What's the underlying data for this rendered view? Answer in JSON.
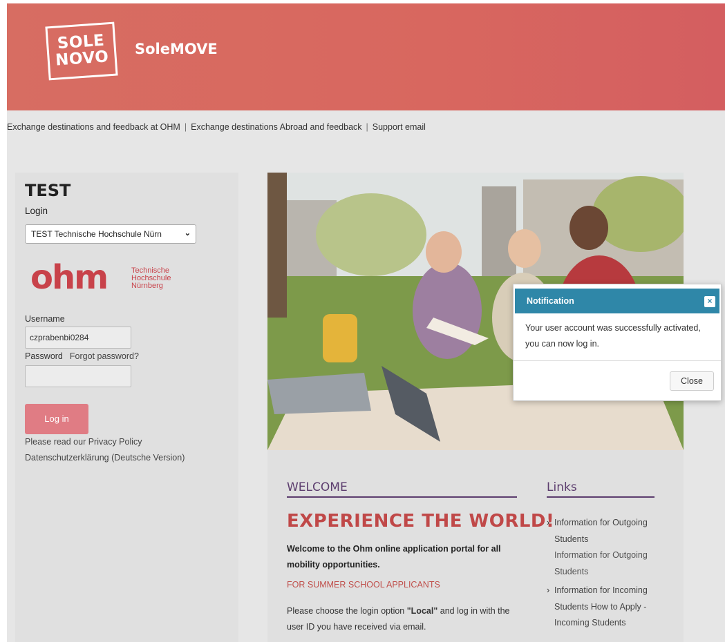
{
  "header": {
    "logo": {
      "line1": "SOLE",
      "line2": "NOVO"
    },
    "app_name": "SoleMOVE"
  },
  "topnav": {
    "items": [
      "Exchange destinations and feedback at OHM",
      "Exchange destinations Abroad and feedback",
      "Support email"
    ],
    "separator": "|"
  },
  "sidebar": {
    "title": "TEST",
    "login_label": "Login",
    "institution_select": "TEST Technische Hochschule Nürn",
    "ohm_logo": {
      "word": "ohm",
      "line1": "Technische",
      "line2": "Hochschule",
      "line3": "Nürnberg"
    },
    "username_label": "Username",
    "username_value": "czprabenbi0284",
    "password_label": "Password",
    "forgot_password": "Forgot password?",
    "password_value": "",
    "login_button": "Log in",
    "privacy_link": "Please read our Privacy Policy",
    "privacy_de_link": "Datenschutzerklärung (Deutsche Version)"
  },
  "content": {
    "welcome_heading": "WELCOME",
    "experience_heading": "EXPERIENCE THE WORLD!",
    "welcome_text": "Welcome to the Ohm online application portal for all mobility opportunities.",
    "summer_heading": "FOR SUMMER SCHOOL APPLICANTS",
    "choose_pre": "Please choose the login option ",
    "choose_bold": "\"Local\"",
    "choose_post": " and log in with the user ID you have received via email.",
    "links_heading": "Links",
    "links": [
      {
        "main": "Information for Outgoing Students",
        "sub": "Information for Outgoing Students"
      },
      {
        "main": "Information for Incoming Students",
        "sub": "How to Apply - Incoming Students"
      }
    ]
  },
  "notification": {
    "title": "Notification",
    "close_x": "×",
    "message": "Your user account was successfully activated, you can now log in.",
    "close_button": "Close"
  },
  "colors": {
    "header": "#d76d62",
    "accent_purple": "#5c3d6e",
    "accent_red": "#c04848",
    "modal_header": "#2f87a8",
    "login_button": "#e07c84"
  }
}
